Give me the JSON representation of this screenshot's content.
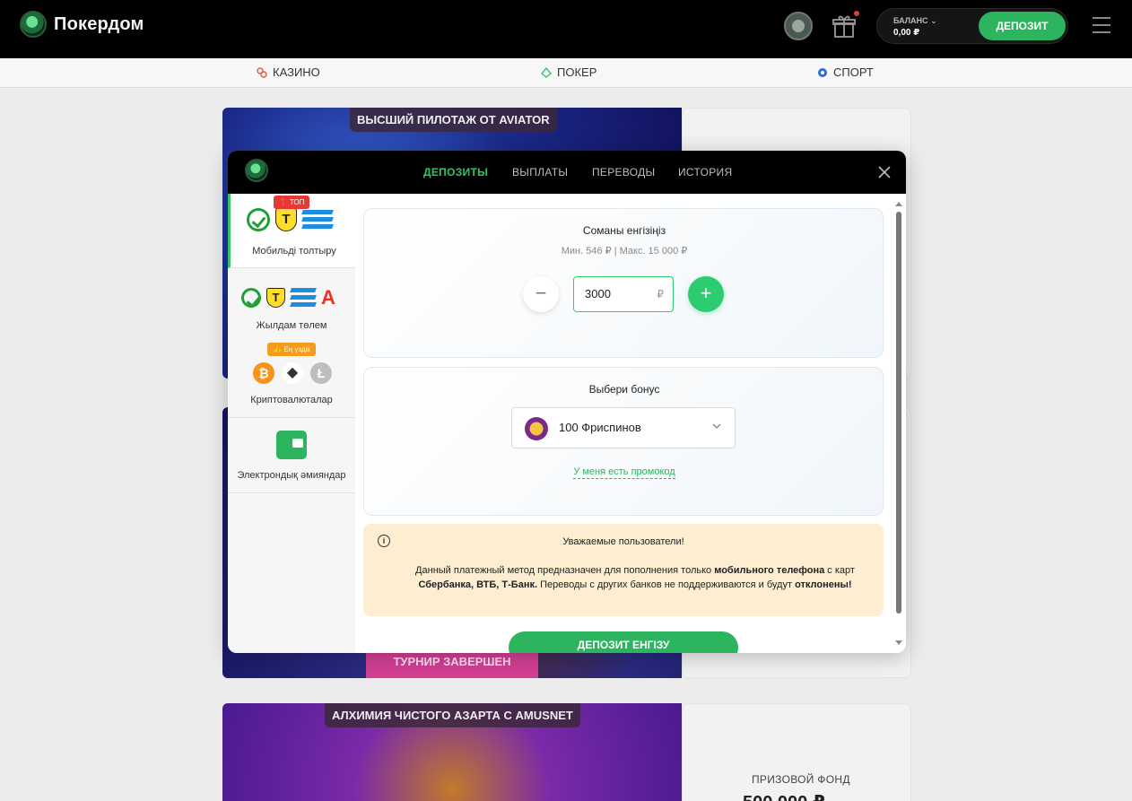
{
  "header": {
    "brand": "Покердом",
    "balance_label": "БАЛАНС",
    "balance_value": "0,00 ₽",
    "deposit_label": "ДЕПОЗИТ"
  },
  "nav": {
    "items": [
      {
        "label": "КАЗИНО",
        "icon": "casino-icon",
        "color": "#e05a4a"
      },
      {
        "label": "ПОКЕР",
        "icon": "poker-icon",
        "color": "#35c46b"
      },
      {
        "label": "СПОРТ",
        "icon": "sport-icon",
        "color": "#2b6fd6"
      }
    ]
  },
  "background": {
    "banner1_title": "ВЫСШИЙ ПИЛОТАЖ ОТ AVIATOR",
    "banner2_status": "ТУРНИР ЗАВЕРШЕН",
    "banner3_title": "АЛХИМИЯ ЧИСТОГО АЗАРТА С AMUSNET",
    "prize_label": "ПРИЗОВОЙ ФОНД",
    "prize_value": "500 000 ₽"
  },
  "modal": {
    "tabs": [
      {
        "label": "ДЕПОЗИТЫ",
        "active": true
      },
      {
        "label": "ВЫПЛАТЫ",
        "active": false
      },
      {
        "label": "ПЕРЕВОДЫ",
        "active": false
      },
      {
        "label": "ИСТОРИЯ",
        "active": false
      }
    ],
    "methods": [
      {
        "label": "Мобильді толтыру",
        "active": true,
        "icons": [
          "sber-icon",
          "tbank-icon",
          "vtb-icon"
        ]
      },
      {
        "label": "Жылдам төлем",
        "badge": "ТОП",
        "icons": [
          "sber-icon",
          "tbank-icon",
          "vtb-icon",
          "alfa-icon"
        ]
      },
      {
        "label": "Криптовалюталар",
        "badge": "Ең үздік",
        "icons": [
          "bitcoin-icon",
          "ethereum-icon",
          "litecoin-icon"
        ]
      },
      {
        "label": "Электрондық әмияндар",
        "icons": [
          "wallet-icon"
        ]
      }
    ],
    "amount": {
      "title": "Соманы енгізіңіз",
      "limits": "Мин. 546 ₽ | Макс. 15 000 ₽",
      "value": "3000",
      "currency": "₽"
    },
    "bonus": {
      "title": "Выбери бонус",
      "selected": "100 Фриспинов",
      "promo_link": "У меня есть промокод"
    },
    "warning": {
      "title": "Уважаемые пользователи!",
      "body_1": "Данный платежный метод предназначен для пополнения только ",
      "body_bold_1": "мобильного телефона",
      "body_2": " с карт ",
      "body_bold_2": "Сбербанка, ВТБ, Т-Банк.",
      "body_3": " Переводы с других банков не поддерживаются и будут ",
      "body_bold_3": "отклонены!"
    },
    "submit_label": "ДЕПОЗИТ ЕНГІЗУ"
  }
}
